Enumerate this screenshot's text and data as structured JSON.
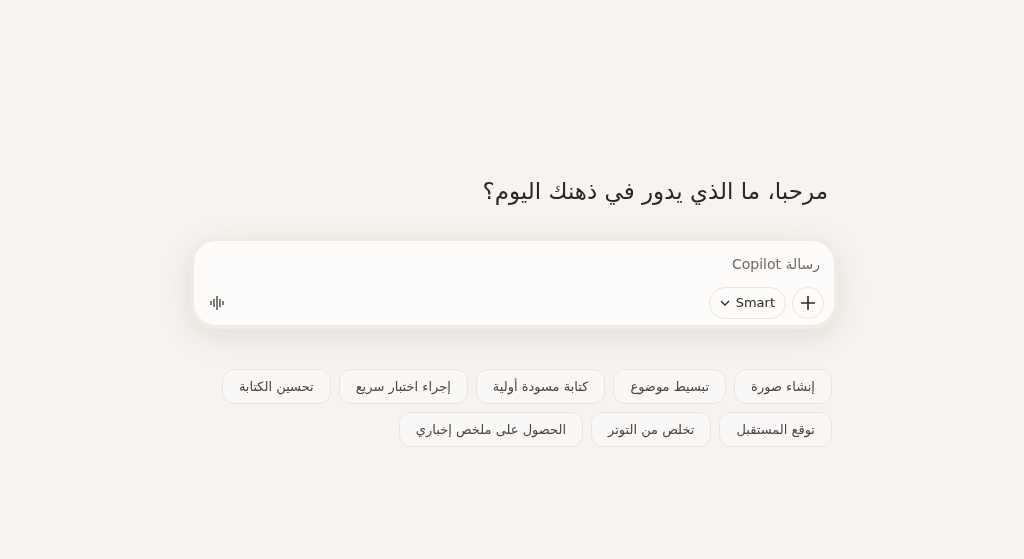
{
  "heading": "مرحبا، ما الذي يدور في ذهنك اليوم؟",
  "composer": {
    "placeholder": "رسالة Copilot",
    "mode": "Smart"
  },
  "suggestions": [
    [
      "إنشاء صورة",
      "تبسيط موضوع",
      "كتابة مسودة أولية",
      "إجراء اختبار سريع",
      "تحسين الكتابة"
    ],
    [
      "توقع المستقبل",
      "تخلص من التوتر",
      "الحصول على ملخص إخباري"
    ]
  ]
}
